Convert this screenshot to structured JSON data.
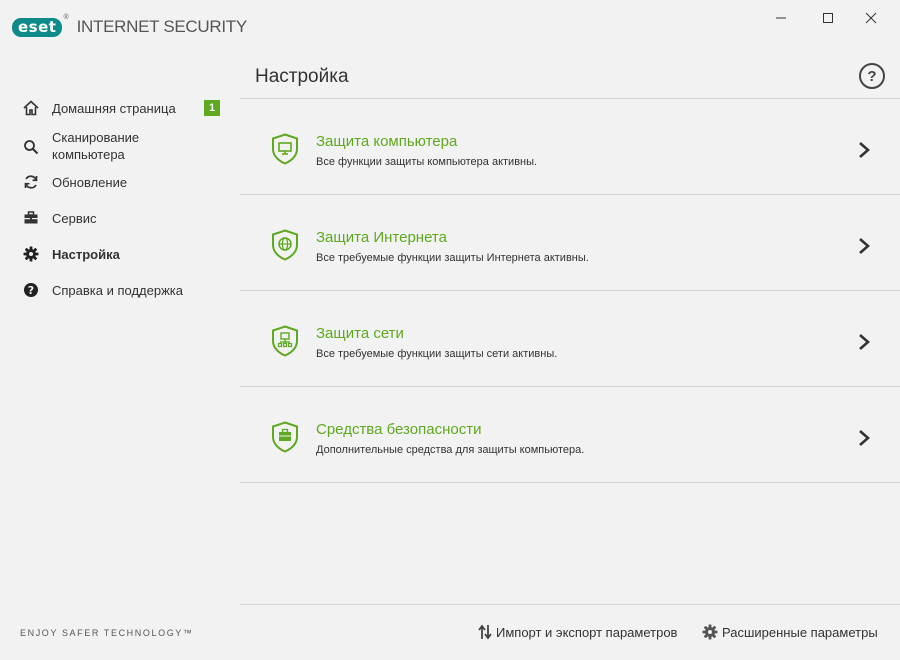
{
  "app": {
    "brand": "eset",
    "product": "INTERNET SECURITY",
    "registered": "®"
  },
  "window_controls": [
    {
      "name": "minimize",
      "glyph": "—"
    },
    {
      "name": "maximize",
      "glyph": "□"
    },
    {
      "name": "close",
      "glyph": "✕"
    }
  ],
  "sidebar": {
    "items": [
      {
        "label": "Домашняя страница",
        "icon": "home-icon",
        "badge": "1"
      },
      {
        "label": "Сканирование компьютера",
        "icon": "search-icon"
      },
      {
        "label": "Обновление",
        "icon": "refresh-icon"
      },
      {
        "label": "Сервис",
        "icon": "toolbox-icon"
      },
      {
        "label": "Настройка",
        "icon": "gear-icon",
        "active": true
      },
      {
        "label": "Справка и поддержка",
        "icon": "help-circle-icon"
      }
    ],
    "tagline": "ENJOY SAFER TECHNOLOGY™"
  },
  "main": {
    "title": "Настройка",
    "help": "?",
    "cards": [
      {
        "title": "Защита компьютера",
        "desc": "Все функции защиты компьютера активны.",
        "icon": "shield-monitor-icon"
      },
      {
        "title": "Защита Интернета",
        "desc": "Все требуемые функции защиты Интернета активны.",
        "icon": "shield-globe-icon"
      },
      {
        "title": "Защита сети",
        "desc": "Все требуемые функции защиты сети активны.",
        "icon": "shield-network-icon"
      },
      {
        "title": "Средства безопасности",
        "desc": "Дополнительные средства для защиты компьютера.",
        "icon": "shield-briefcase-icon"
      }
    ],
    "footer": {
      "import_export": "Импорт и экспорт параметров",
      "advanced": "Расширенные параметры"
    }
  },
  "colors": {
    "accent_green": "#5ea91f",
    "brand_teal": "#0e8a8a",
    "background": "#f2f2f2"
  }
}
